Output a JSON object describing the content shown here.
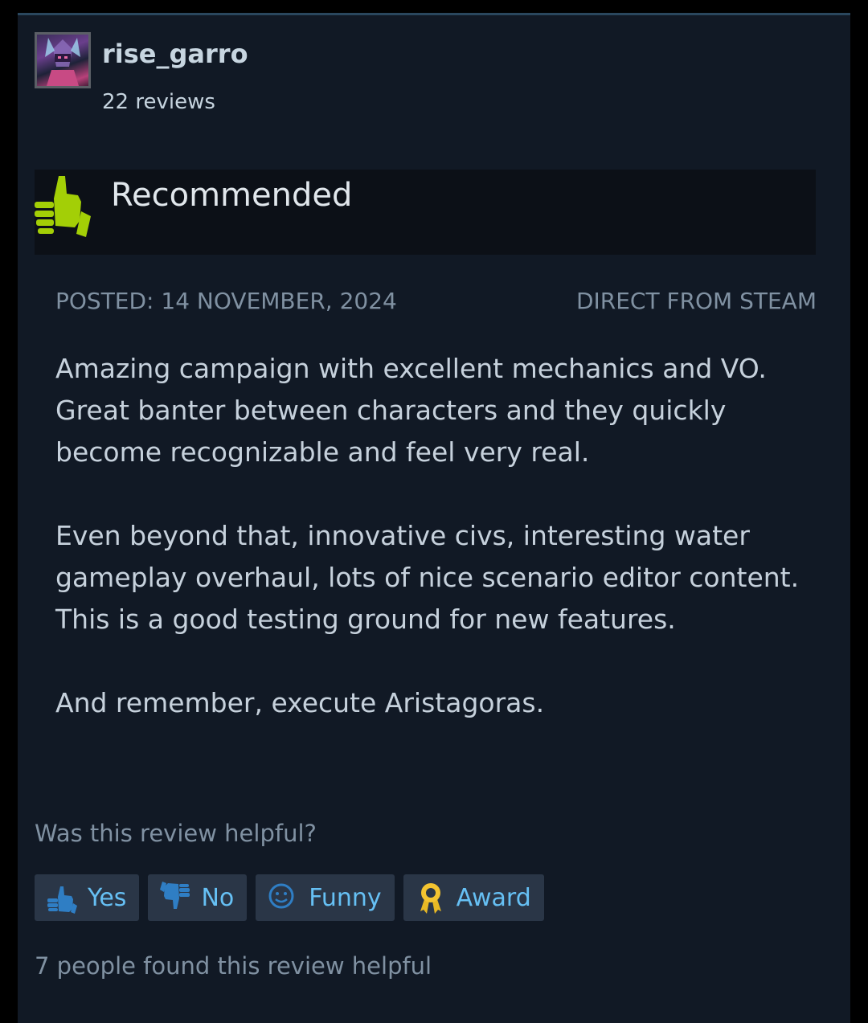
{
  "reviewer": {
    "username": "rise_garro",
    "review_count": "22 reviews"
  },
  "verdict": {
    "label": "Recommended",
    "color": "#a3cf06"
  },
  "meta": {
    "posted": "POSTED: 14 NOVEMBER, 2024",
    "source": "DIRECT FROM STEAM"
  },
  "review": {
    "paragraphs": [
      "Amazing campaign with excellent mechanics and VO. Great banter between characters and they quickly become recognizable and feel very real.",
      "Even beyond that, innovative civs, interesting water gameplay overhaul, lots of nice scenario editor content. This is a good testing ground for new features.",
      "And remember, execute Aristagoras."
    ]
  },
  "helpfulness": {
    "question": "Was this review helpful?",
    "buttons": {
      "yes": {
        "label": "Yes",
        "icon": "thumbs-up-icon"
      },
      "no": {
        "label": "No",
        "icon": "thumbs-down-icon"
      },
      "funny": {
        "label": "Funny",
        "icon": "smiley-icon"
      },
      "award": {
        "label": "Award",
        "icon": "award-ribbon-icon"
      }
    },
    "summary": "7 people found this review helpful"
  },
  "colors": {
    "card_bg": "#111925",
    "accent_link": "#66c0f4",
    "muted_text": "#8091a2",
    "button_bg": "#2a3647"
  }
}
